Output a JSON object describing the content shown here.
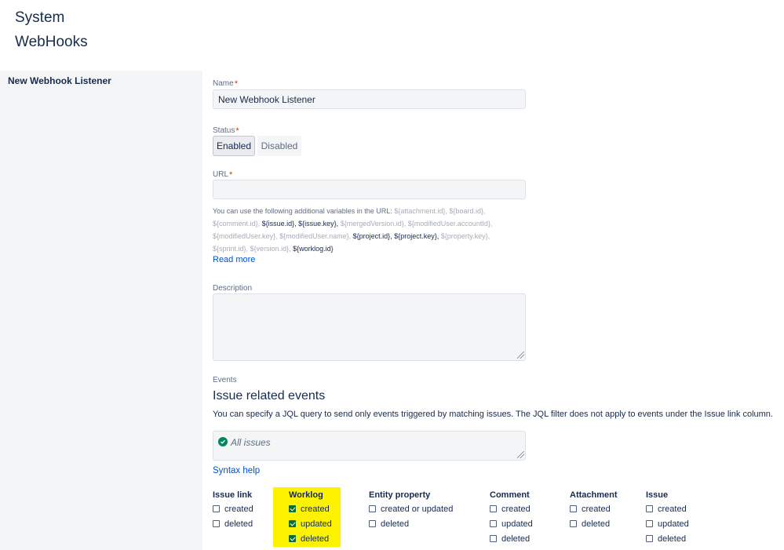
{
  "breadcrumb": {
    "system": "System",
    "webhooks": "WebHooks"
  },
  "sidebar": {
    "title": "New Webhook Listener"
  },
  "form": {
    "name_label": "Name",
    "name_value": "New Webhook Listener",
    "required_mark": "*",
    "status_label": "Status",
    "status_enabled": "Enabled",
    "status_disabled": "Disabled",
    "url_label": "URL",
    "url_value": "",
    "url_help_prefix": "You can use the following additional variables in the URL:",
    "url_vars": [
      {
        "text": "${attachment.id},",
        "dim": true
      },
      {
        "text": "${board.id},",
        "dim": true
      },
      {
        "text": "${comment.id},",
        "dim": true
      },
      {
        "text": "${issue.id},",
        "dim": false
      },
      {
        "text": "${issue.key},",
        "dim": false
      },
      {
        "text": "${mergedVersion.id},",
        "dim": true
      },
      {
        "text": "${modifiedUser.accountId},",
        "dim": true
      },
      {
        "text": "${modifiedUser.key},",
        "dim": true
      },
      {
        "text": "${modifiedUser.name},",
        "dim": true
      },
      {
        "text": "${project.id},",
        "dim": false
      },
      {
        "text": "${project.key},",
        "dim": false
      },
      {
        "text": "${property.key},",
        "dim": true
      },
      {
        "text": "${sprint.id},",
        "dim": true
      },
      {
        "text": "${version.id},",
        "dim": true
      },
      {
        "text": "${worklog.id}",
        "dim": false
      }
    ],
    "read_more": "Read more",
    "description_label": "Description",
    "description_value": "",
    "events_label": "Events",
    "issue_events_title": "Issue related events",
    "issue_events_desc": "You can specify a JQL query to send only events triggered by matching issues. The JQL filter does not apply to events under the Issue link column.",
    "jql_value": "All issues",
    "syntax_help": "Syntax help"
  },
  "event_columns": [
    {
      "name": "Issue link",
      "items": [
        {
          "label": "created",
          "checked": false
        },
        {
          "label": "deleted",
          "checked": false
        }
      ]
    },
    {
      "name": "Worklog",
      "items": [
        {
          "label": "created",
          "checked": true
        },
        {
          "label": "updated",
          "checked": true
        },
        {
          "label": "deleted",
          "checked": true
        }
      ]
    },
    {
      "name": "Entity property",
      "items": [
        {
          "label": "created or updated",
          "checked": false
        },
        {
          "label": "deleted",
          "checked": false
        }
      ]
    },
    {
      "name": "Comment",
      "items": [
        {
          "label": "created",
          "checked": false
        },
        {
          "label": "updated",
          "checked": false
        },
        {
          "label": "deleted",
          "checked": false
        }
      ]
    },
    {
      "name": "Attachment",
      "items": [
        {
          "label": "created",
          "checked": false
        },
        {
          "label": "deleted",
          "checked": false
        }
      ]
    },
    {
      "name": "Issue",
      "items": [
        {
          "label": "created",
          "checked": false
        },
        {
          "label": "updated",
          "checked": false
        },
        {
          "label": "deleted",
          "checked": false
        }
      ]
    }
  ],
  "colors": {
    "accent": "#0052cc",
    "required": "#de350b",
    "checked": "#0b6e35",
    "highlight": "#fdf200"
  }
}
